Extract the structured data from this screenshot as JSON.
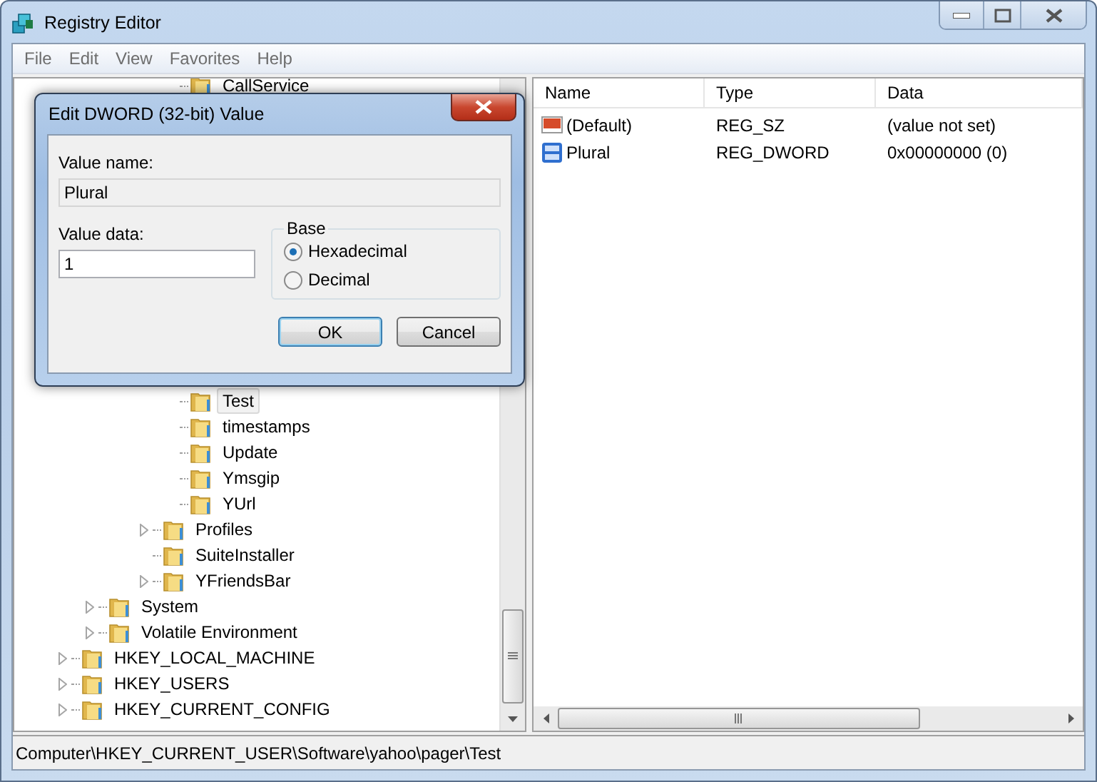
{
  "window": {
    "title": "Registry Editor"
  },
  "menu": [
    "File",
    "Edit",
    "View",
    "Favorites",
    "Help"
  ],
  "tree": [
    {
      "children": [
        {
          "children": [
            {
              "children": [
                {
                  "children": [
                    {
                      "label": "CallService",
                      "selected": false
                    },
                    {
                      "label": "Test",
                      "selected": true
                    },
                    {
                      "label": "timestamps",
                      "selected": false
                    },
                    {
                      "label": "Update",
                      "selected": false
                    },
                    {
                      "label": "Ymsgip",
                      "selected": false
                    },
                    {
                      "label": "YUrl",
                      "selected": false
                    }
                  ]
                },
                {
                  "label": "Profiles",
                  "selected": false,
                  "expanded": false
                },
                {
                  "label": "SuiteInstaller",
                  "selected": false
                },
                {
                  "label": "YFriendsBar",
                  "selected": false,
                  "expanded": false
                }
              ]
            }
          ]
        },
        {
          "label": "System",
          "selected": false,
          "expanded": false
        },
        {
          "label": "Volatile Environment",
          "selected": false,
          "expanded": false
        }
      ]
    },
    {
      "label": "HKEY_LOCAL_MACHINE",
      "selected": false,
      "expanded": false
    },
    {
      "label": "HKEY_USERS",
      "selected": false,
      "expanded": false
    },
    {
      "label": "HKEY_CURRENT_CONFIG",
      "selected": false,
      "expanded": false
    }
  ],
  "values": {
    "columns": [
      "Name",
      "Type",
      "Data"
    ],
    "rows": [
      {
        "kind": "string",
        "name": "(Default)",
        "type": "REG_SZ",
        "data": "(value not set)"
      },
      {
        "kind": "binary",
        "name": "Plural",
        "type": "REG_DWORD",
        "data": "0x00000000 (0)"
      }
    ]
  },
  "status_bar": "Computer\\HKEY_CURRENT_USER\\Software\\yahoo\\pager\\Test",
  "dialog": {
    "title": "Edit DWORD (32-bit) Value",
    "value_name_label": "Value name:",
    "value_name": "Plural",
    "value_data_label": "Value data:",
    "value_data": "1",
    "base_label": "Base",
    "base_options": [
      {
        "label": "Hexadecimal",
        "selected": true
      },
      {
        "label": "Decimal",
        "selected": false
      }
    ],
    "buttons": [
      {
        "label": "OK",
        "default": true
      },
      {
        "label": "Cancel",
        "default": false
      }
    ]
  }
}
